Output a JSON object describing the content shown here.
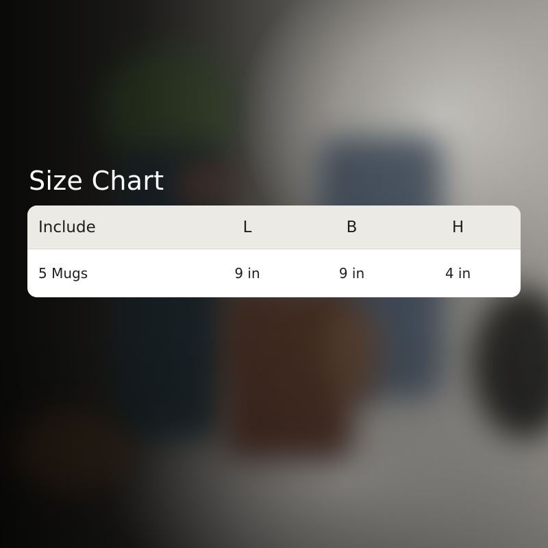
{
  "title": "Size Chart",
  "table": {
    "headers": [
      "Include",
      "L",
      "B",
      "H"
    ],
    "rows": [
      [
        "5 Mugs",
        "9 in",
        "9 in",
        "4 in"
      ]
    ]
  },
  "colors": {
    "header_bg": "#ebeae5",
    "body_bg": "#ffffff",
    "title_text": "#ffffff",
    "cell_text": "#1d1d1d"
  }
}
